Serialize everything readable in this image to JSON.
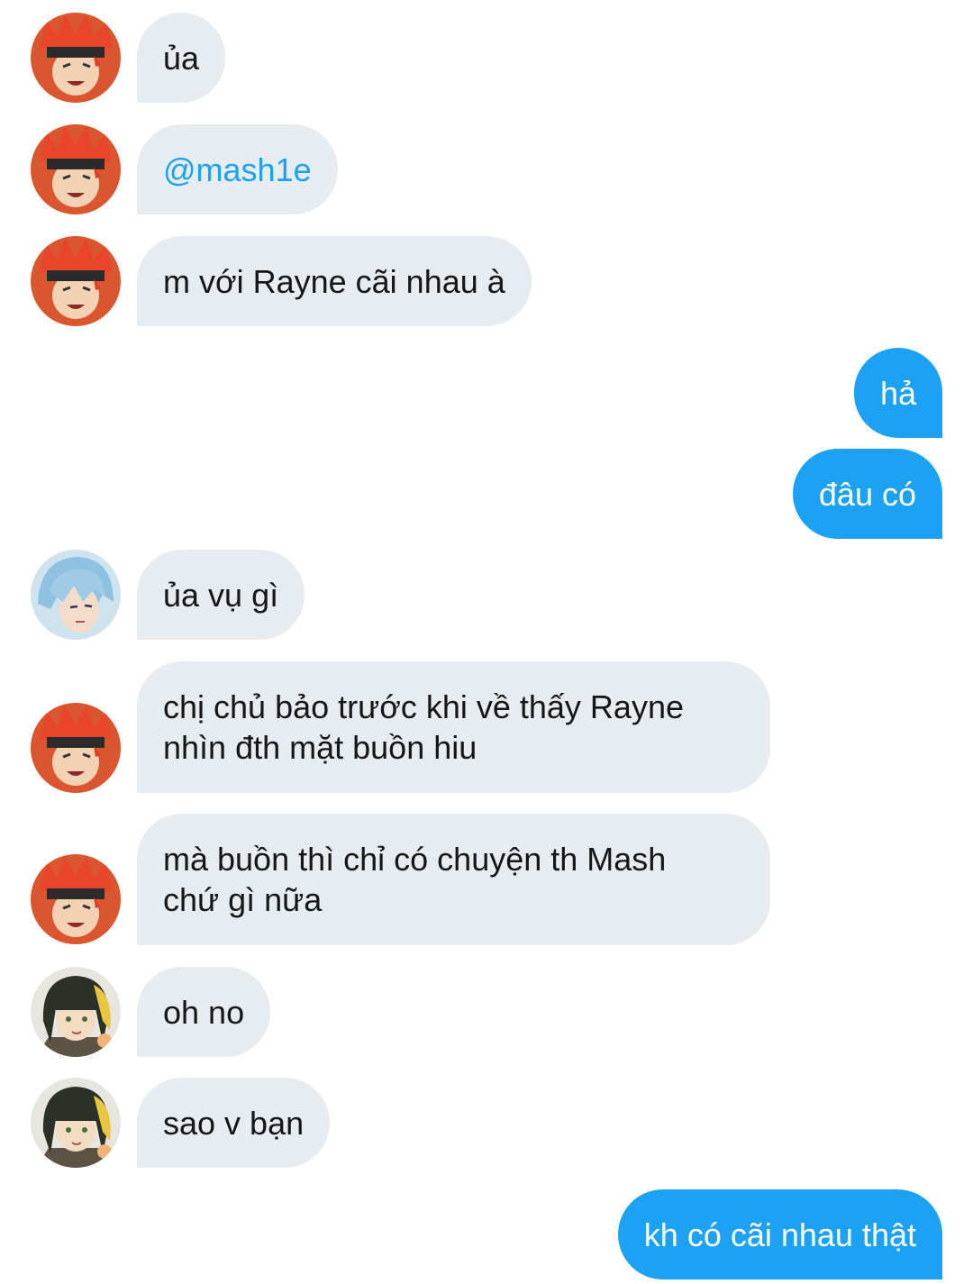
{
  "messages": [
    {
      "sender": "red-hair",
      "text": "ủa"
    },
    {
      "sender": "red-hair",
      "text": "@mash1e",
      "mention": true
    },
    {
      "sender": "red-hair",
      "text": "m với Rayne cãi nhau à"
    },
    {
      "sender": "me",
      "text": "hả"
    },
    {
      "sender": "me",
      "text": "đâu có"
    },
    {
      "sender": "blue-hair",
      "text": "ủa vụ gì"
    },
    {
      "sender": "red-hair",
      "text": "chị chủ bảo trước khi về thấy Rayne\nnhìn đth mặt buồn hiu"
    },
    {
      "sender": "red-hair",
      "text": "mà buồn thì chỉ có chuyện th Mash\nchứ gì nữa"
    },
    {
      "sender": "dark-hair",
      "text": "oh no"
    },
    {
      "sender": "dark-hair",
      "text": "sao v bạn"
    },
    {
      "sender": "me",
      "text": "kh có cãi nhau thật"
    }
  ],
  "colors": {
    "incoming_bubble": "#e6ecf0",
    "outgoing_bubble": "#1da1f2",
    "mention": "#1da1f2",
    "text": "#14171a"
  },
  "icons": {
    "red_hair_avatar": "red-hair-avatar-icon",
    "blue_hair_avatar": "blue-hair-avatar-icon",
    "dark_hair_avatar": "dark-hair-avatar-icon"
  }
}
